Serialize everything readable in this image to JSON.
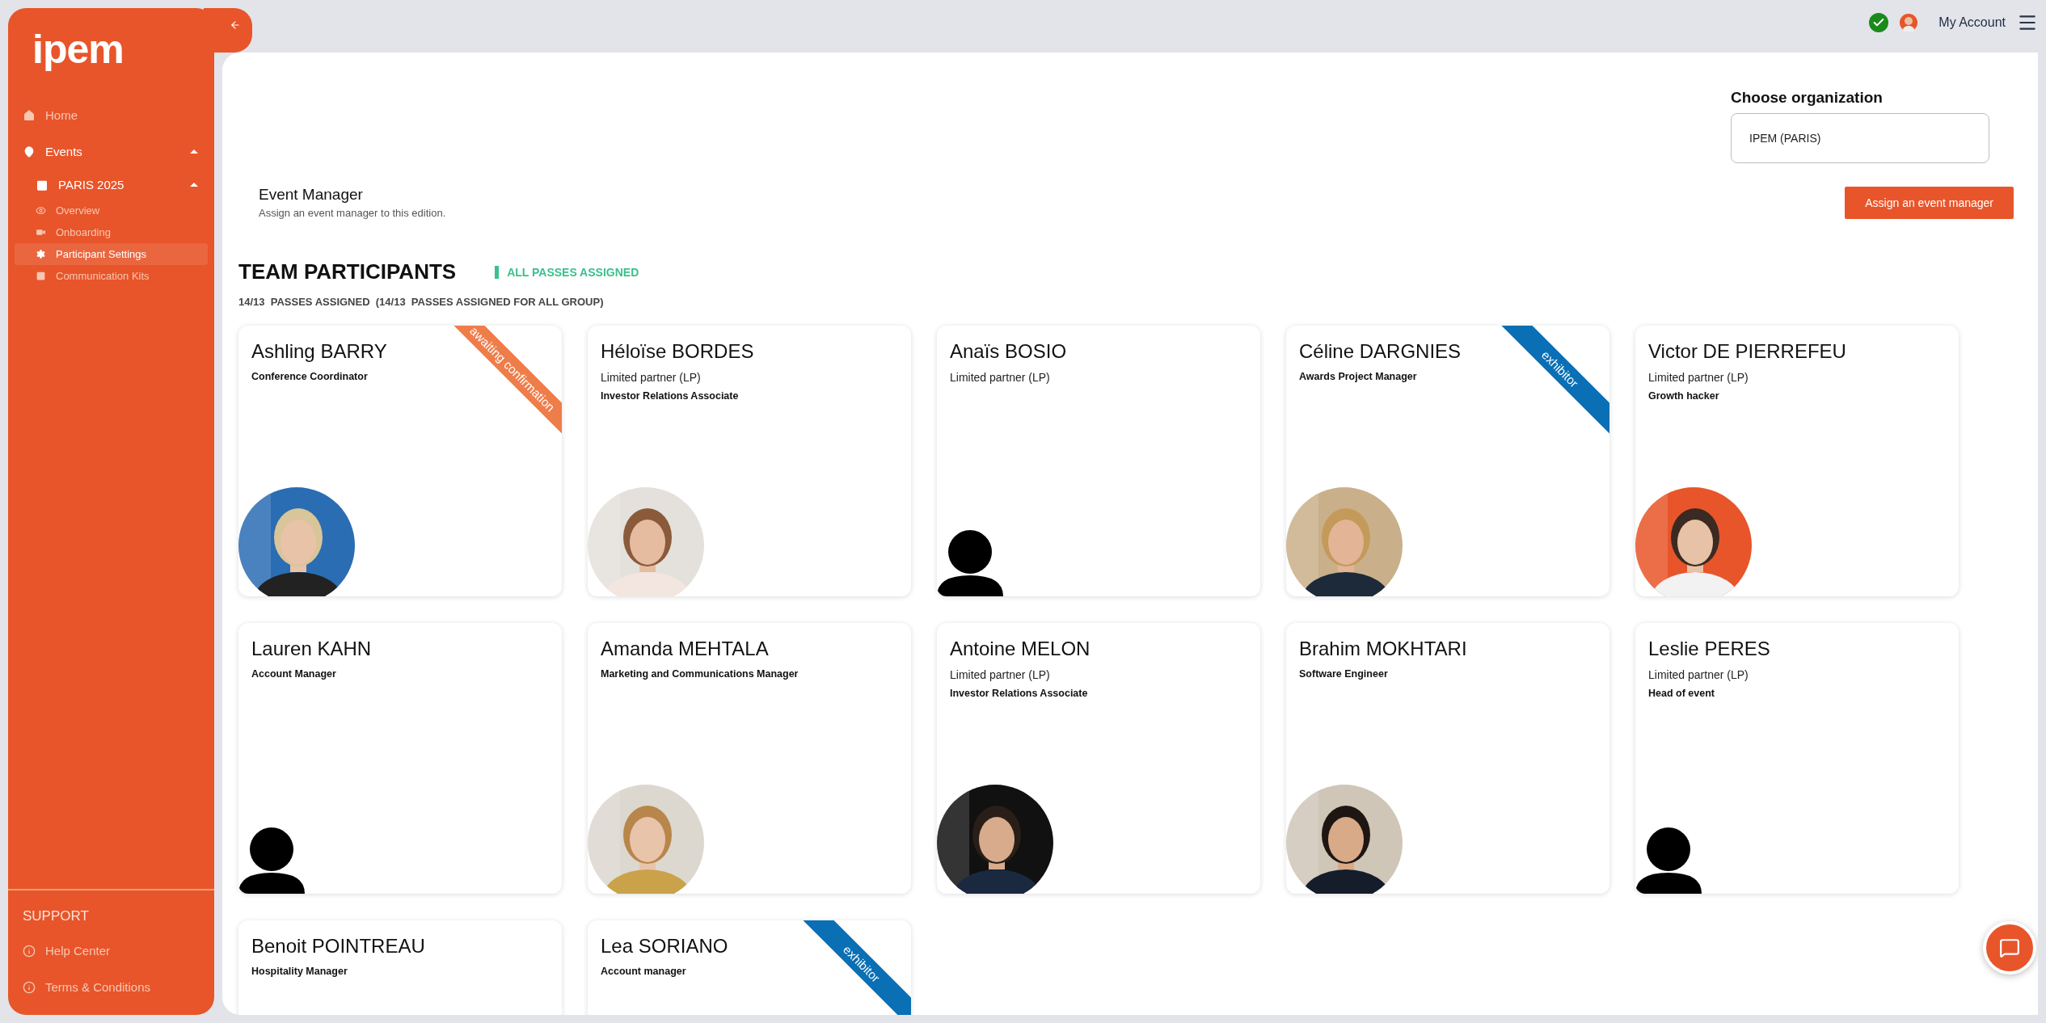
{
  "sidebar": {
    "logo": "ipem",
    "items": [
      {
        "label": "Home",
        "selected": false
      },
      {
        "label": "Events",
        "selected": false,
        "expanded": true,
        "children": [
          {
            "label": "PARIS 2025",
            "selected": false,
            "expanded": true,
            "children": [
              {
                "label": "Overview",
                "selected": false
              },
              {
                "label": "Onboarding",
                "selected": false
              },
              {
                "label": "Participant Settings",
                "selected": true
              },
              {
                "label": "Communication Kits",
                "selected": false
              }
            ]
          }
        ]
      }
    ],
    "support": {
      "title": "SUPPORT",
      "items": [
        {
          "label": "Help Center"
        },
        {
          "label": "Terms & Conditions"
        }
      ]
    }
  },
  "header": {
    "account": "My Account"
  },
  "organization": {
    "label": "Choose organization",
    "value": "IPEM (PARIS)"
  },
  "event_manager": {
    "title": "Event Manager",
    "description": "Assign an event manager to this edition.",
    "button": "Assign an event manager"
  },
  "team": {
    "title": "TEAM PARTICIPANTS",
    "status": "ALL PASSES ASSIGNED",
    "summary": "14/13  PASSES ASSIGNED  (14/13  PASSES ASSIGNED FOR ALL GROUP)",
    "participants": [
      {
        "name": "Ashling BARRY",
        "role": "Conference Coordinator",
        "ribbon": {
          "text": "awaiting confirmation",
          "color": "#ef7d4a"
        },
        "kind": "picture"
      },
      {
        "name": "Héloïse BORDES",
        "company": "Limited partner (LP)",
        "role": "Investor Relations Associate",
        "kind": "picture"
      },
      {
        "name": "Anaïs BOSIO",
        "company": "Limited partner (LP)",
        "kind": "silhouette"
      },
      {
        "name": "Céline DARGNIES",
        "role": "Awards Project Manager",
        "ribbon": {
          "text": "exhibitor",
          "color": "#0a6fb4"
        },
        "kind": "picture"
      },
      {
        "name": "Victor DE PIERREFEU",
        "company": "Limited partner (LP)",
        "role": "Growth hacker",
        "kind": "picture"
      },
      {
        "name": "Lauren KAHN",
        "role": "Account Manager",
        "kind": "silhouette"
      },
      {
        "name": "Amanda MEHTALA",
        "role": "Marketing and Communications Manager",
        "kind": "picture"
      },
      {
        "name": "Antoine MELON",
        "company": "Limited partner (LP)",
        "role": "Investor Relations Associate",
        "kind": "picture"
      },
      {
        "name": "Brahim MOKHTARI",
        "role": "Software Engineer",
        "kind": "picture"
      },
      {
        "name": "Leslie PERES",
        "company": "Limited partner (LP)",
        "role": "Head of event",
        "kind": "silhouette"
      },
      {
        "name": "Benoit POINTREAU",
        "role": "Hospitality Manager"
      },
      {
        "name": "Lea SORIANO",
        "role": "Account manager",
        "ribbon": {
          "text": "exhibitor",
          "color": "#0a6fb4"
        }
      }
    ]
  }
}
